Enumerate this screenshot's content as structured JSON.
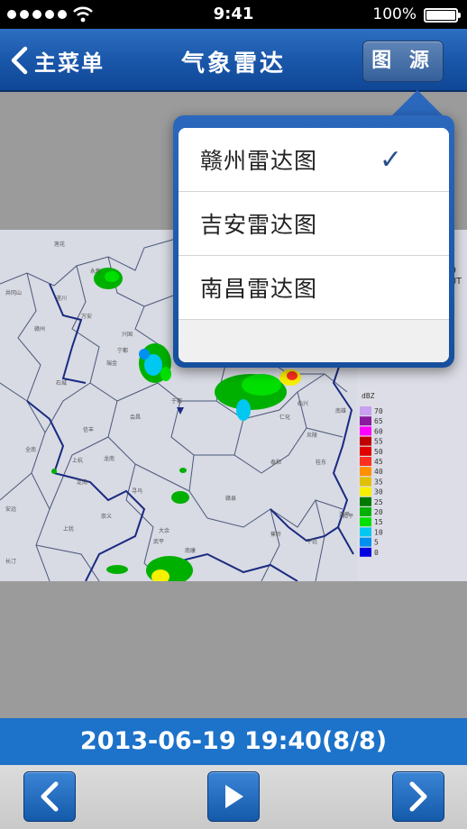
{
  "status_bar": {
    "time": "9:41",
    "battery": "100%"
  },
  "nav": {
    "back_label": "主菜单",
    "title": "气象雷达",
    "source_button": "图 源"
  },
  "source_menu": {
    "items": [
      {
        "label": "赣州雷达图",
        "selected": true
      },
      {
        "label": "吉安雷达图",
        "selected": false
      },
      {
        "label": "南昌雷达图",
        "selected": false
      }
    ]
  },
  "radar": {
    "legend_title": "dBZ",
    "legend": [
      {
        "value": "70",
        "color": "#c8a0f0"
      },
      {
        "value": "65",
        "color": "#8a1aa0"
      },
      {
        "value": "60",
        "color": "#ff00ff"
      },
      {
        "value": "55",
        "color": "#c00000"
      },
      {
        "value": "50",
        "color": "#e00000"
      },
      {
        "value": "45",
        "color": "#ff3020"
      },
      {
        "value": "40",
        "color": "#ff9000"
      },
      {
        "value": "35",
        "color": "#e0c000"
      },
      {
        "value": "30",
        "color": "#f8f000"
      },
      {
        "value": "25",
        "color": "#007a00"
      },
      {
        "value": "20",
        "color": "#00b000"
      },
      {
        "value": "15",
        "color": "#00e000"
      },
      {
        "value": "10",
        "color": "#00c8f0"
      },
      {
        "value": "5",
        "color": "#0090f0"
      },
      {
        "value": "0",
        "color": "#0000e0"
      }
    ],
    "partial_label_1": "9",
    "partial_label_2": "UT",
    "place_names": [
      "莲花",
      "永新",
      "井冈山",
      "遂川",
      "万安",
      "赣州",
      "兴国",
      "宁都",
      "石城",
      "瑞金",
      "于都",
      "会昌",
      "信丰",
      "龙南",
      "全南",
      "定南",
      "寻乌",
      "安远",
      "上犹",
      "崇义",
      "大余",
      "南康",
      "赣县",
      "泰和",
      "炎陵",
      "桂东",
      "仁化",
      "始兴",
      "南雄",
      "和平",
      "连平",
      "平远",
      "蕉岭",
      "长汀",
      "武平",
      "上杭"
    ]
  },
  "date_label": "2013-06-19 19:40(8/8)",
  "toolbar": {
    "prev_icon": "chevron-left-icon",
    "play_icon": "play-icon",
    "next_icon": "chevron-right-icon"
  }
}
